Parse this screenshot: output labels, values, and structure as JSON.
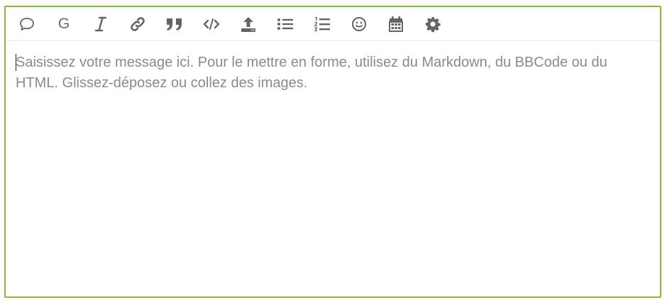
{
  "toolbar": {
    "buttons": [
      {
        "icon": "speech-bubble-icon",
        "title": "quote-reply"
      },
      {
        "icon": "bold-icon",
        "label": "G"
      },
      {
        "icon": "italic-icon"
      },
      {
        "icon": "link-icon"
      },
      {
        "icon": "blockquote-icon"
      },
      {
        "icon": "code-icon"
      },
      {
        "icon": "upload-icon"
      },
      {
        "icon": "bullet-list-icon"
      },
      {
        "icon": "numbered-list-icon"
      },
      {
        "icon": "emoji-icon"
      },
      {
        "icon": "calendar-icon"
      },
      {
        "icon": "gear-icon"
      }
    ]
  },
  "composer": {
    "value": "",
    "placeholder": "Saisissez votre message ici. Pour le mettre en forme, utilisez du Markdown, du BBCode ou du HTML. Glissez-déposez ou collez des images."
  },
  "colors": {
    "border": "#8ab837",
    "icon": "#646464",
    "placeholder": "#8a8a8a"
  }
}
